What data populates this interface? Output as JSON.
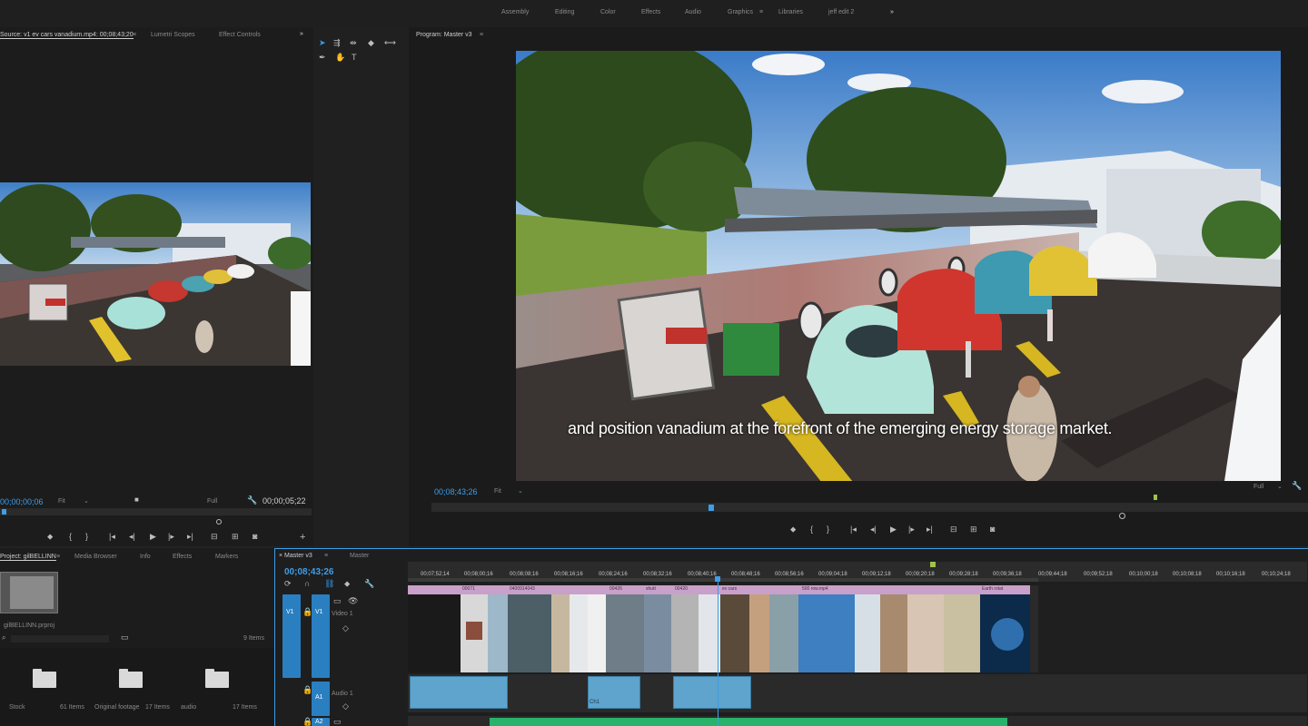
{
  "workspaces": {
    "tabs": [
      "Assembly",
      "Editing",
      "Color",
      "Effects",
      "Audio",
      "Graphics",
      "Libraries",
      "jeff edit 2"
    ],
    "active": "Graphics",
    "overflow": "»"
  },
  "source_panel": {
    "tabs": [
      "Source: v1 ev cars vanadium.mp4: 00;08;43;20",
      "Lumetri Scopes",
      "Effect Controls"
    ],
    "timecode_left": "00;00;00;06",
    "fit_label": "Fit",
    "quality_label": "Full",
    "timecode_right": "00;00;05;22"
  },
  "tools_icons": [
    "selection-tool-icon",
    "track-select-icon",
    "ripple-edit-icon",
    "razor-icon",
    "slip-icon",
    "pen-icon",
    "hand-icon",
    "type-icon"
  ],
  "program_panel": {
    "title": "Program: Master v3",
    "timecode": "00;08;43;26",
    "fit_label": "Fit",
    "quality_label": "Full",
    "caption": "and position vanadium at the forefront of the emerging energy storage market."
  },
  "project_panel": {
    "tabs": [
      "Project: gilBELLINN",
      "Media Browser",
      "Info",
      "Effects",
      "Markers"
    ],
    "filename": "gilBELLINN.prproj",
    "item_count": "9 Items",
    "bins": [
      {
        "name": "Stock",
        "count": "61 Items"
      },
      {
        "name": "Original footage",
        "count": "17 Items"
      },
      {
        "name": "audio",
        "count": "17 Items"
      }
    ]
  },
  "timeline": {
    "tabs": [
      "Master v3",
      "Master"
    ],
    "timecode": "00;08;43;26",
    "ruler": [
      "00;07;52;14",
      "00;08;00;16",
      "00;08;08;16",
      "00;08;16;16",
      "00;08;24;16",
      "00;08;32;16",
      "00;08;40;16",
      "00;08;48;16",
      "00;08;56;16",
      "00;09;04;18",
      "00;09;12;18",
      "00;09;20;18",
      "00;09;28;18",
      "00;09;36;18",
      "00;09;44;18",
      "00;09;52;18",
      "00;10;00;18",
      "00;10;08;18",
      "00;10;16;18",
      "00;10;24;18"
    ],
    "tracks": {
      "video_label": "Video 1",
      "v1": "V1",
      "audio_label": "Audio 1",
      "a1": "A1",
      "a2": "A2"
    },
    "clip_labels": [
      "00071",
      "0400914043",
      "00426",
      "shutt",
      "00420",
      "ev cars",
      "500 row.mp4",
      "Earth rotat"
    ],
    "audio_labels": [
      "Ch1"
    ]
  },
  "colors": {
    "accent": "#3d9eea",
    "panel": "#1a1a1a",
    "clip_label": "#c9a0c9",
    "audio_clip": "#5fa4cc",
    "audio_green": "#27b36b"
  }
}
